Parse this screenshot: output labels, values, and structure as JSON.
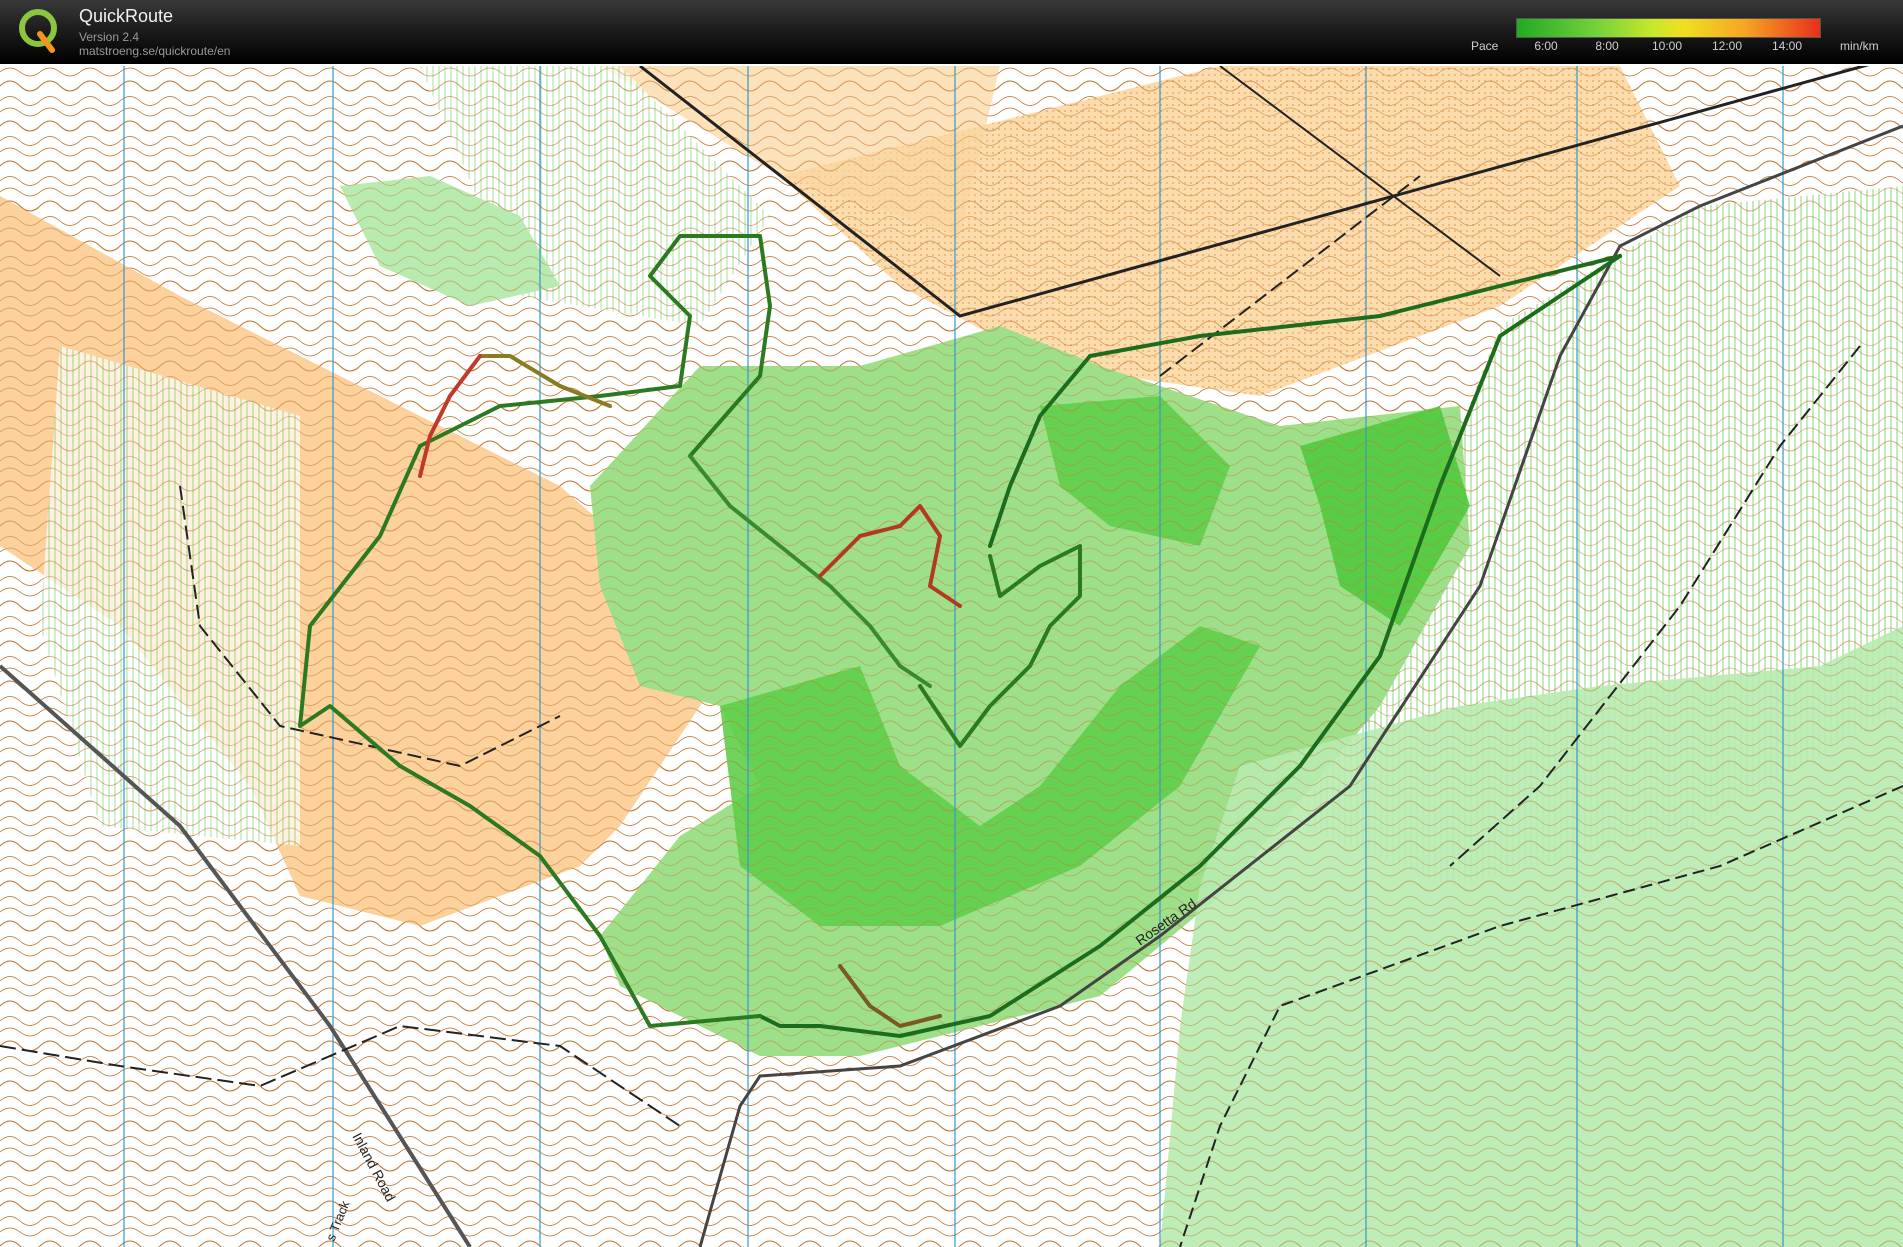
{
  "app": {
    "name": "QuickRoute",
    "version": "Version 2.4",
    "url": "matstroeng.se/quickroute/en"
  },
  "legend": {
    "label": "Pace",
    "unit": "min/km",
    "ticks": [
      "6:00",
      "8:00",
      "10:00",
      "12:00",
      "14:00"
    ],
    "colors": [
      "#22aa22",
      "#9adf3a",
      "#f0e020",
      "#f6a623",
      "#e8301c"
    ]
  },
  "map": {
    "road_labels": [
      "Rosetta Rd",
      "Inland Road",
      "s Track"
    ]
  }
}
